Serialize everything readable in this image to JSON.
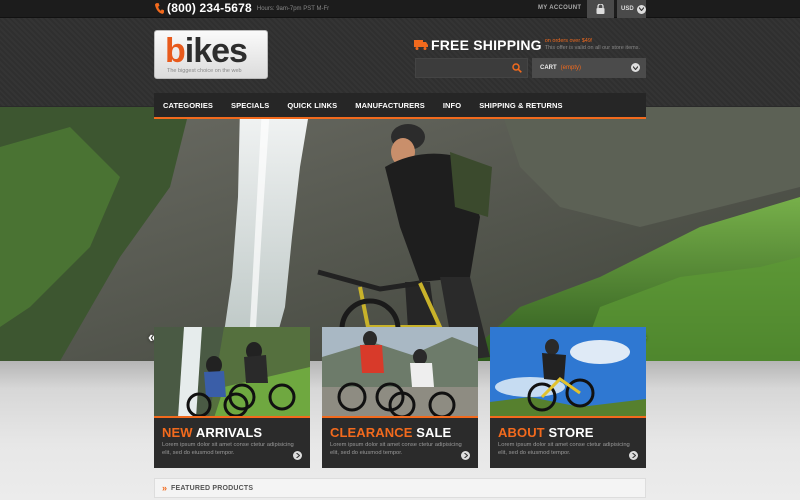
{
  "topbar": {
    "phone": "(800) 234-5678",
    "hours": "Hours: 9am-7pm PST M-Fr",
    "account": "MY ACCOUNT",
    "currency": "USD"
  },
  "header": {
    "logo": {
      "accent_letter": "b",
      "rest": "ikes",
      "tagline": "The biggest choice on the web"
    },
    "shipping": {
      "title": "FREE SHIPPING",
      "offer": "on orders over $49!",
      "note": "This offer is valid on all our store items."
    },
    "search": {
      "placeholder": ""
    },
    "cart": {
      "label": "CART",
      "status": "(empty)"
    }
  },
  "nav": {
    "items": [
      {
        "label": "CATEGORIES"
      },
      {
        "label": "SPECIALS"
      },
      {
        "label": "QUICK LINKS"
      },
      {
        "label": "MANUFACTURERS"
      },
      {
        "label": "INFO"
      },
      {
        "label": "SHIPPING & RETURNS"
      }
    ]
  },
  "slider": {
    "prev": "«",
    "next": "»"
  },
  "cards": [
    {
      "highlight": "NEW",
      "title": "ARRIVALS",
      "desc": "Lorem ipsum dolor sit amet conse ctetur adipisicing elit, sed do eiusmod tempor."
    },
    {
      "highlight": "CLEARANCE",
      "title": "SALE",
      "desc": "Lorem ipsum dolor sit amet conse ctetur adipisicing elit, sed do eiusmod tempor."
    },
    {
      "highlight": "ABOUT",
      "title": "STORE",
      "desc": "Lorem ipsum dolor sit amet conse ctetur adipisicing elit, sed do eiusmod tempor."
    }
  ],
  "featured": {
    "arrows": "»",
    "title": "FEATURED PRODUCTS"
  },
  "colors": {
    "accent": "#f26a1d",
    "dark": "#2b2b2b"
  }
}
